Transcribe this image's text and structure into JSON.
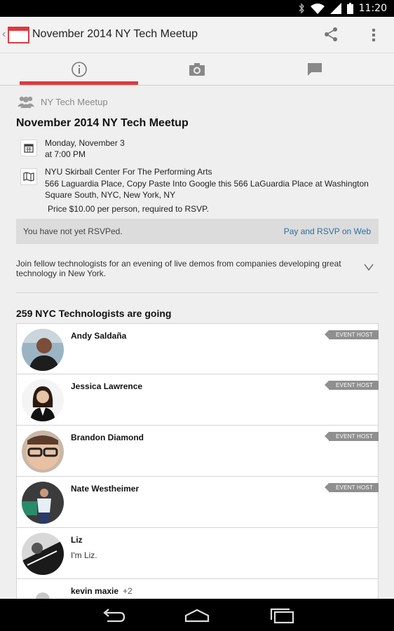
{
  "status_bar": {
    "time": "11:20",
    "icons": [
      "bluetooth-icon",
      "wifi-icon",
      "signal-icon",
      "battery-icon"
    ]
  },
  "action_bar": {
    "title": "November 2014 NY Tech Meetup",
    "icons": {
      "share": "share-icon",
      "overflow": "overflow-menu-icon",
      "app": "calendar-app-icon"
    }
  },
  "tabs": [
    {
      "icon": "info-icon",
      "selected": true
    },
    {
      "icon": "camera-icon",
      "selected": false
    },
    {
      "icon": "comment-icon",
      "selected": false
    }
  ],
  "event": {
    "group_name": "NY Tech Meetup",
    "title": "November 2014 NY Tech Meetup",
    "date": "Monday, November 3",
    "time": "at 7:00 PM",
    "venue": "NYU Skirball Center For The Performing Arts",
    "address": "566 Laguardia Place, Copy Paste Into Google this 566 LaGuardia Place at Washington Square South, NYC, New York, NY",
    "price": "Price $10.00 per person, required to RSVP.",
    "rsvp_status": "You have not yet RSVPed.",
    "rsvp_link": "Pay and RSVP on Web",
    "description": "Join fellow technologists for an evening of live demos from companies developing great technology in New York."
  },
  "attendees_header": "259 NYC Technologists are going",
  "attendees": [
    {
      "name": "Andy Saldaña",
      "badge": "EVENT HOST",
      "bio": "",
      "extra": ""
    },
    {
      "name": "Jessica Lawrence",
      "badge": "EVENT HOST",
      "bio": "",
      "extra": ""
    },
    {
      "name": "Brandon Diamond",
      "badge": "EVENT HOST",
      "bio": "",
      "extra": ""
    },
    {
      "name": "Nate Westheimer",
      "badge": "EVENT HOST",
      "bio": "",
      "extra": ""
    },
    {
      "name": "Liz",
      "badge": "",
      "bio": "I'm Liz.",
      "extra": ""
    },
    {
      "name": "kevin maxie",
      "badge": "",
      "bio": "",
      "extra": "+2"
    }
  ],
  "colors": {
    "accent": "#e0393e",
    "link": "#2e6fa0",
    "badge": "#8f8f8f"
  },
  "nav_bar": [
    "back-icon",
    "home-icon",
    "recent-apps-icon"
  ]
}
